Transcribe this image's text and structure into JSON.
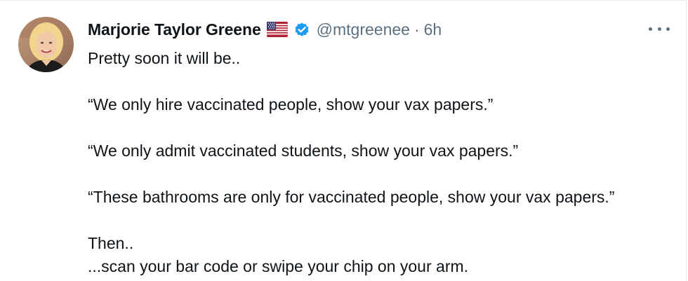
{
  "author": {
    "display_name": "Marjorie Taylor Greene",
    "handle": "@mtgreenee",
    "separator": "·",
    "timestamp": "6h",
    "flag_icon": "us-flag-icon",
    "verified_icon": "verified-badge-icon",
    "verified_color": "#1d9bf0"
  },
  "more_menu_icon": "more-options-icon",
  "tweet": {
    "lines": [
      "Pretty soon it will be..",
      "“We only hire vaccinated people, show your vax papers.”",
      "“We only admit vaccinated students, show your vax papers.”",
      "“These bathrooms are only for vaccinated people, show your vax papers.”",
      "Then..",
      "...scan your bar code or swipe your chip on your arm."
    ]
  },
  "colors": {
    "text": "#0f1419",
    "secondary": "#5b7083",
    "border": "#e6ecf0"
  }
}
